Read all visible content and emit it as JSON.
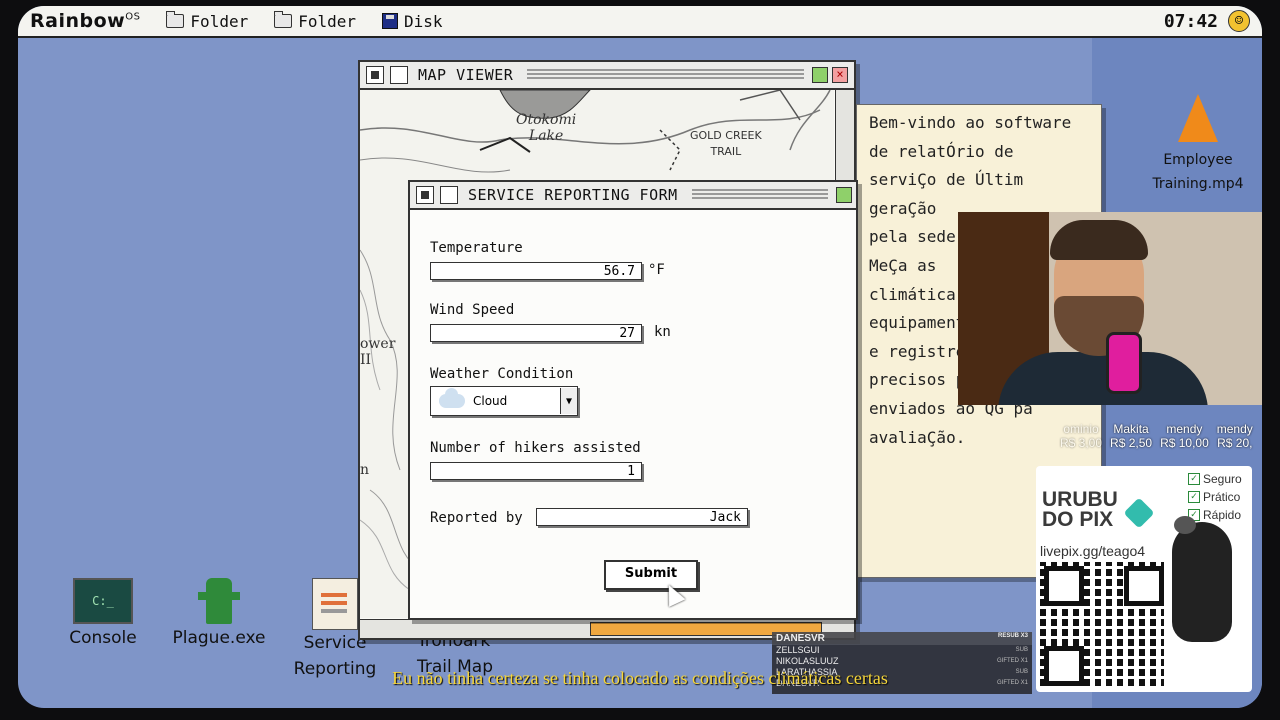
{
  "menubar": {
    "logo": "Rainbow",
    "logo_sup": "OS",
    "items": [
      {
        "label": "Folder",
        "icon": "folder-icon"
      },
      {
        "label": "Folder",
        "icon": "folder-icon"
      },
      {
        "label": "Disk",
        "icon": "disk-icon"
      }
    ],
    "clock": "07:42"
  },
  "map_window": {
    "title": "MAP VIEWER",
    "labels": {
      "lake": "Otokomi\nLake",
      "trail": "GOLD CREEK\nTRAIL",
      "tower": "ower\nII",
      "n": "n"
    }
  },
  "form_window": {
    "title": "SERVICE REPORTING FORM",
    "temperature": {
      "label": "Temperature",
      "value": "56.7",
      "unit": "°F"
    },
    "wind": {
      "label": "Wind Speed",
      "value": "27",
      "unit": "kn"
    },
    "weather": {
      "label": "Weather Condition",
      "value": "Cloud"
    },
    "hikers": {
      "label": "Number of hikers assisted",
      "value": "1"
    },
    "reporter": {
      "label": "Reported by",
      "value": "Jack"
    },
    "submit": "Submit"
  },
  "note": {
    "lines": [
      "Bem-vindo ao software",
      "de relatÓrio de",
      "serviÇo de Últim",
      "geraÇão",
      "pela sede",
      "MeÇa as",
      "climática",
      "equipamento fornecido",
      "e registre dados",
      "precisos para sere",
      "enviados ao QG pa",
      "avaliaÇão."
    ]
  },
  "desktop_icons": [
    {
      "label": "Console",
      "icon": "console-icon"
    },
    {
      "label": "Plague.exe",
      "icon": "hydrant-icon"
    },
    {
      "label": "Service\nReporting",
      "icon": "document-icon"
    },
    {
      "label": "Ironoark\nTrail Map",
      "icon": "map-icon"
    },
    {
      "label": "Employee\nTraining.mp4",
      "icon": "traffic-cone-icon"
    }
  ],
  "donors": [
    {
      "name": "ominio",
      "amount": "R$ 3,00"
    },
    {
      "name": "Makita",
      "amount": "R$ 2,50"
    },
    {
      "name": "mendy",
      "amount": "R$ 10,00"
    },
    {
      "name": "mendy",
      "amount": "R$ 20,"
    }
  ],
  "urubu": {
    "title_line1": "URUBU",
    "title_line2": "DO PIX",
    "checks": [
      "Seguro",
      "Prático",
      "Rápido"
    ],
    "url": "livepix.gg/teago4"
  },
  "chat": {
    "header": "DANESVR",
    "header_tag": "RESUB X3",
    "rows": [
      {
        "name": "ZELLSGUI",
        "tag": "SUB"
      },
      {
        "name": "NIKOLASLUUZ",
        "tag": "GIFTED X1"
      },
      {
        "name": "LARATHASSIA",
        "tag": "SUB"
      },
      {
        "name": "DANESVR",
        "tag": "GIFTED X1"
      }
    ]
  },
  "subtitle": "Eu não tinha certeza se tinha colocado as condições climáticas certas",
  "colors": {
    "desktop": "#7f95c8",
    "accent_scroll": "#f0a840",
    "subtitle": "#f6d63a"
  }
}
